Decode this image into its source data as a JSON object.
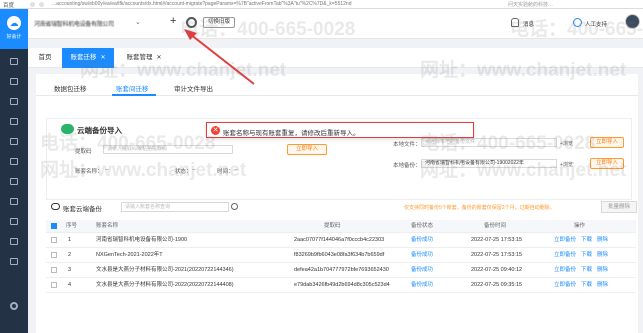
{
  "browser": {
    "name": "百度",
    "url": "...accounting/sw/eb00y/ea/ea/tfk/accounts/dx.html#/account-migrate?pageParams=%7B\"activeFromTab\"%3A\"tu\"%2C%7D&_k=5512nd",
    "right_text": "问天实验舱的科技…"
  },
  "sidebar": {
    "logo_label": "好会计",
    "items": [
      "home",
      "voucher",
      "ledger",
      "report",
      "tax",
      "asset",
      "cash",
      "invoice",
      "salary",
      "archive",
      "settings"
    ]
  },
  "header": {
    "account_name": "河南省瑞智科机电设备有限公司",
    "plus": "+",
    "old_version_button": "切换旧版",
    "message": "消息",
    "support": "人工支持"
  },
  "tabs": [
    {
      "label": "首页",
      "active": false,
      "closable": false
    },
    {
      "label": "账套迁移",
      "active": true,
      "closable": true
    },
    {
      "label": "账套管理",
      "active": false,
      "closable": true
    }
  ],
  "subtabs": [
    {
      "label": "数据包迁移",
      "active": false
    },
    {
      "label": "账套间迁移",
      "active": true
    },
    {
      "label": "审计文件导出",
      "active": false
    }
  ],
  "import_box": {
    "title": "云端备份导入",
    "code_label": "提取码",
    "code_placeholder": "请录入提取码或粘贴提取码",
    "import_button": "立即导入",
    "account_label": "账套名称：",
    "account_value": "--",
    "status_label": "状态：",
    "status_value": "--",
    "time_label": "时间：",
    "time_value": "--",
    "file_label": "本地文件：",
    "file_placeholder": "请选择本地的备份文件",
    "browse": "+浏览",
    "file_label2": "本地备份：",
    "file_value2": "河南省瑞智科机电设备有限公司-19002022年",
    "import_button2": "立即导入",
    "import_button3": "立即导入"
  },
  "toast": {
    "type": "error",
    "message": "账套名称与现有账套重复，请修改后重新导入。"
  },
  "list": {
    "title": "账套云端备份",
    "search_placeholder": "请输入账套名称查询",
    "warning": "仅支持同时备份5个账套，备份的账套仅保留2个月，过期自动删除。",
    "batch_button": "批量删除",
    "columns": [
      "序号",
      "账套名称",
      "提取码",
      "备份状态",
      "备份时间",
      "操作"
    ],
    "rows": [
      {
        "no": "1",
        "name": "河南省瑞智科机电设备有限公司-1900",
        "code": "2aac07077f144046a7f0cccb4c22303",
        "status": "备份成功",
        "time": "2022-07-25 17:53:15",
        "actions": [
          "立即备份",
          "下载",
          "删除"
        ]
      },
      {
        "no": "2",
        "name": "NXGenTech-2021-2022年T",
        "code": "f83269b9fb6043e08fa3f634b7b659df",
        "status": "备份成功",
        "time": "2022-07-25 17:53:15",
        "actions": [
          "立即备份",
          "下载",
          "删除"
        ]
      },
      {
        "no": "3",
        "name": "文水县是大燕分子材料有限公司-2021(20220722144346)",
        "code": "defea42a1b704777972bfe7693652430",
        "status": "备份成功",
        "time": "2022-07-25 09:40:12",
        "actions": [
          "立即备份",
          "下载",
          "删除"
        ]
      },
      {
        "no": "4",
        "name": "文水县是大燕分子材料有限公司-2022(20220722144408)",
        "code": "e79dab3426fb49d2b694d8c305c523d4",
        "status": "备份成功",
        "time": "2022-07-25 09:35:15",
        "actions": [
          "立即备份",
          "下载",
          "删除"
        ]
      }
    ]
  },
  "watermark": {
    "phone": "电话：400-665-0028",
    "site": "网址：www.chanjet.net"
  },
  "colors": {
    "primary": "#1a8cff",
    "sidebar": "#243246",
    "accent_orange": "#ff7a00",
    "error": "#e23c3c"
  }
}
